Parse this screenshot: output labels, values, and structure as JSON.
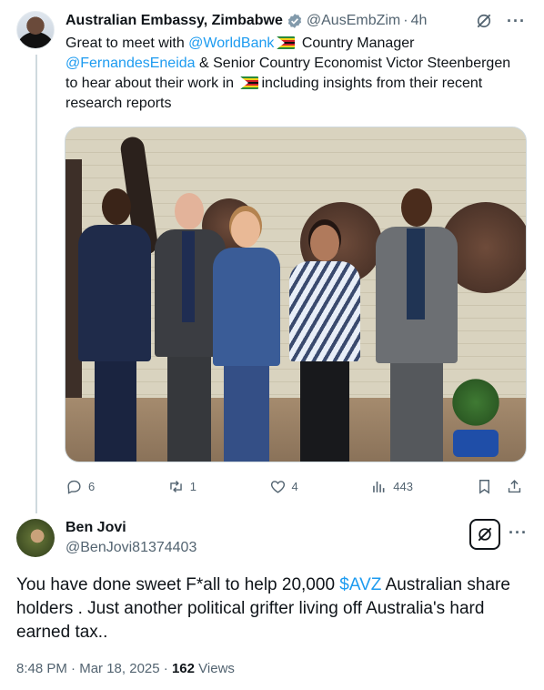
{
  "tweet": {
    "author_name": "Australian Embassy, Zimbabwe",
    "handle": "@AusEmbZim",
    "separator": "·",
    "time": "4h",
    "text_part1": "Great to meet with ",
    "mention_worldbank": "@WorldBank",
    "text_part2": " Country Manager ",
    "mention_fernandes": "@FernandesEneida",
    "text_part3": " & Senior Country Economist Victor Steenbergen to hear about their work in ",
    "text_part4": "including insights from their recent research reports",
    "flag_icon": "zimbabwe-flag-emoji",
    "photo_alt": "Five people posing for a group photo",
    "stats": {
      "replies": "6",
      "reposts": "1",
      "likes": "4",
      "views": "443"
    }
  },
  "reply": {
    "author_name": "Ben Jovi",
    "handle": "@BenJovi81374403",
    "text_before": "You have done sweet F*all to help 20,000 ",
    "cashtag": "$AVZ",
    "text_after": " Australian share holders . Just another political grifter living off Australia's hard earned tax..",
    "time": "8:48 PM",
    "separator": "·",
    "date": "Mar 18, 2025",
    "separator2": "·",
    "views_count": "162",
    "views_label": "Views"
  },
  "icons": [
    "verified-badge-icon",
    "grok-icon",
    "more-icon",
    "reply-icon",
    "repost-icon",
    "like-icon",
    "views-icon",
    "bookmark-icon",
    "share-icon"
  ],
  "colors": {
    "link": "#1d9bf0",
    "secondary_text": "#536471",
    "primary_text": "#0f1419",
    "verified": "#829aab"
  }
}
